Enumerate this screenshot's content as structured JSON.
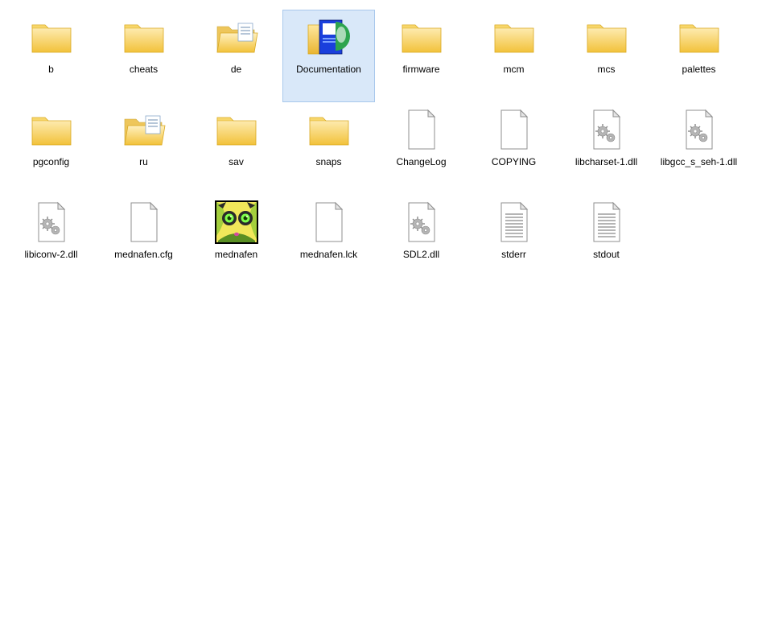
{
  "items": [
    {
      "name": "b",
      "type": "folder",
      "selected": false
    },
    {
      "name": "cheats",
      "type": "folder",
      "selected": false
    },
    {
      "name": "de",
      "type": "folder_open",
      "selected": false
    },
    {
      "name": "Documentation",
      "type": "folder_doc",
      "selected": true
    },
    {
      "name": "firmware",
      "type": "folder",
      "selected": false
    },
    {
      "name": "mcm",
      "type": "folder",
      "selected": false
    },
    {
      "name": "mcs",
      "type": "folder",
      "selected": false
    },
    {
      "name": "palettes",
      "type": "folder",
      "selected": false
    },
    {
      "name": "pgconfig",
      "type": "folder",
      "selected": false
    },
    {
      "name": "ru",
      "type": "folder_open",
      "selected": false
    },
    {
      "name": "sav",
      "type": "folder",
      "selected": false
    },
    {
      "name": "snaps",
      "type": "folder",
      "selected": false
    },
    {
      "name": "ChangeLog",
      "type": "file_blank",
      "selected": false
    },
    {
      "name": "COPYING",
      "type": "file_blank",
      "selected": false
    },
    {
      "name": "libcharset-1.dll",
      "type": "file_dll",
      "selected": false
    },
    {
      "name": "libgcc_s_seh-1.dll",
      "type": "file_dll",
      "selected": false
    },
    {
      "name": "libiconv-2.dll",
      "type": "file_dll",
      "selected": false
    },
    {
      "name": "mednafen.cfg",
      "type": "file_blank",
      "selected": false
    },
    {
      "name": "mednafen",
      "type": "mednafen_exe",
      "selected": false
    },
    {
      "name": "mednafen.lck",
      "type": "file_blank",
      "selected": false
    },
    {
      "name": "SDL2.dll",
      "type": "file_dll",
      "selected": false
    },
    {
      "name": "stderr",
      "type": "file_text",
      "selected": false
    },
    {
      "name": "stdout",
      "type": "file_text",
      "selected": false
    }
  ],
  "colors": {
    "folder_light": "#fde9a9",
    "folder_dark": "#f3c94e",
    "paper": "#ffffff",
    "paper_border": "#9a9a9a"
  }
}
